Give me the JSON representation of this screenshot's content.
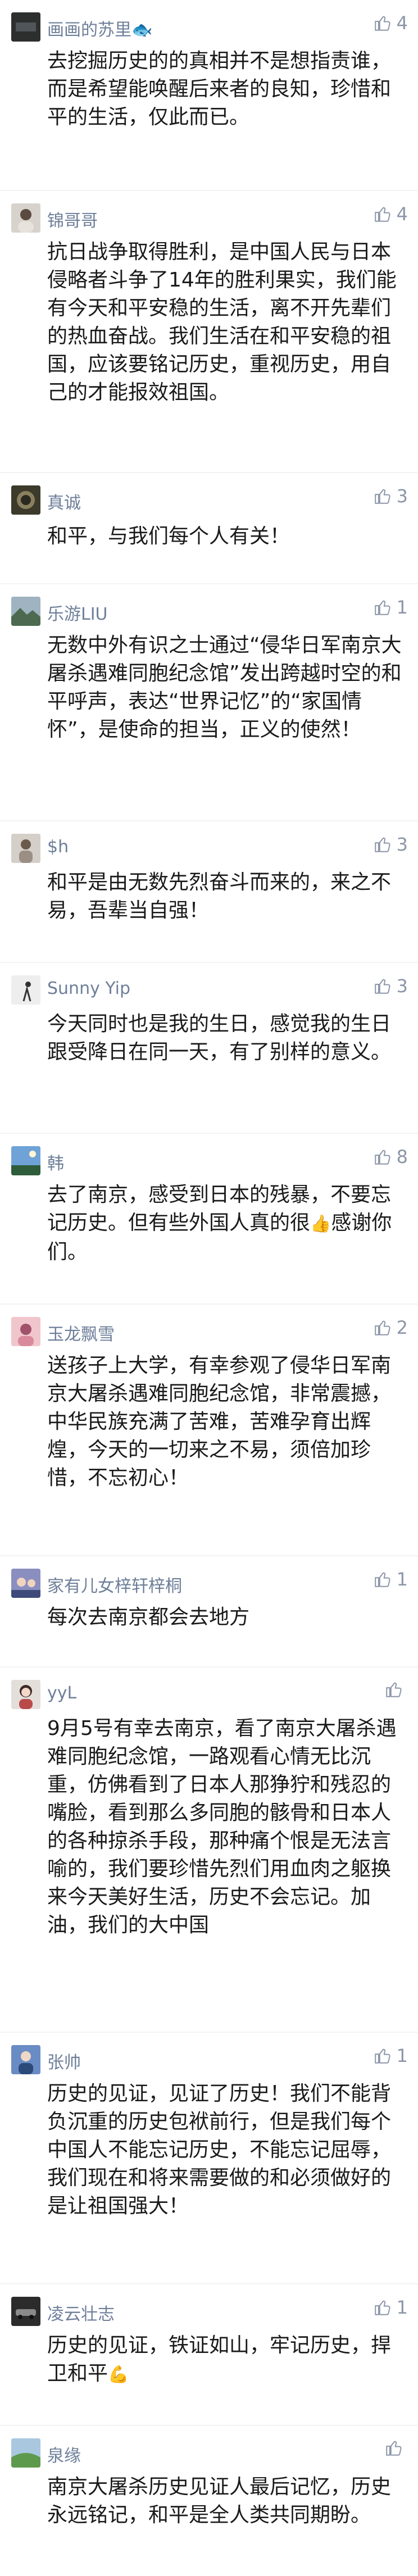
{
  "colors": {
    "background": "#f3f3f3",
    "card": "#ffffff",
    "author_name": "#6e7f99",
    "body_text": "#1a1a1a",
    "like_icon": "#8c96a8"
  },
  "comments": [
    {
      "author": "画画的苏里",
      "author_emoji": "🐟",
      "likes": "4",
      "avatar_icon": "dark-avatar-icon",
      "text": "去挖掘历史的的真相并不是想指责谁，而是希望能唤醒后来者的良知，珍惜和平的生活，仅此而已。"
    },
    {
      "author": "锦哥哥",
      "likes": "4",
      "avatar_icon": "portrait-avatar-icon",
      "text": "抗日战争取得胜利，是中国人民与日本侵略者斗争了14年的胜利果实，我们能有今天和平安稳的生活，离不开先辈们的热血奋战。我们生活在和平安稳的祖国，应该要铭记历史，重视历史，用自己的才能报效祖国。"
    },
    {
      "author": "真诚",
      "likes": "3",
      "avatar_icon": "dark-olive-avatar-icon",
      "text": "和平，与我们每个人有关！"
    },
    {
      "author": "乐游LIU",
      "likes": "1",
      "avatar_icon": "landscape-avatar-icon",
      "text": "无数中外有识之士通过“侵华日军南京大屠杀遇难同胞纪念馆”发出跨越时空的和平呼声，表达“世界记忆”的“家国情怀”，是使命的担当，正义的使然！"
    },
    {
      "author": "$h",
      "likes": "3",
      "avatar_icon": "person-avatar-icon",
      "text": "和平是由无数先烈奋斗而来的，来之不易，吾辈当自强！"
    },
    {
      "author": "Sunny Yip",
      "likes": "3",
      "avatar_icon": "figure-avatar-icon",
      "text": "今天同时也是我的生日，感觉我的生日跟受降日在同一天，有了别样的意义。"
    },
    {
      "author": "韩",
      "likes": "8",
      "avatar_icon": "sky-avatar-icon",
      "text_before_emoji": "去了南京，感受到日本的残暴，不要忘记历史。但有些外国人真的很",
      "text_emoji": "👍",
      "text_after_emoji": "感谢你们。"
    },
    {
      "author": "玉龙飘雪",
      "likes": "2",
      "avatar_icon": "pink-avatar-icon",
      "text": "送孩子上大学，有幸参观了侵华日军南京大屠杀遇难同胞纪念馆，非常震撼，中华民族充满了苦难，苦难孕育出辉煌，今天的一切来之不易，须倍加珍惜，不忘初心！"
    },
    {
      "author": "家有儿女梓轩梓桐",
      "likes": "1",
      "avatar_icon": "kids-avatar-icon",
      "text": "每次去南京都会去地方"
    },
    {
      "author": "yyL",
      "likes": "",
      "avatar_icon": "girl-avatar-icon",
      "text": "9月5号有幸去南京，看了南京大屠杀遇难同胞纪念馆，一路观看心情无比沉重，仿佛看到了日本人那狰狞和残忍的嘴脸，看到那么多同胞的骸骨和日本人的各种掠杀手段，那种痛个恨是无法言喻的，我们要珍惜先烈们用血肉之躯换来今天美好生活，历史不会忘记。加油，我们的大中国"
    },
    {
      "author": "张帅",
      "likes": "1",
      "avatar_icon": "blue-avatar-icon",
      "text": "历史的见证，见证了历史！我们不能背负沉重的历史包袱前行，但是我们每个中国人不能忘记历史，不能忘记屈辱，我们现在和将来需要做的和必须做好的是让祖国强大！"
    },
    {
      "author": "凌云壮志",
      "likes": "1",
      "avatar_icon": "dark-car-avatar-icon",
      "text_before_emoji": "历史的见证，铁证如山，牢记历史，捍卫和平",
      "text_emoji": "💪",
      "text_after_emoji": ""
    },
    {
      "author": "泉缘",
      "likes": "",
      "avatar_icon": "nature-avatar-icon",
      "text": "南京大屠杀历史见证人最后记忆，历史永远铭记，和平是全人类共同期盼。"
    }
  ]
}
